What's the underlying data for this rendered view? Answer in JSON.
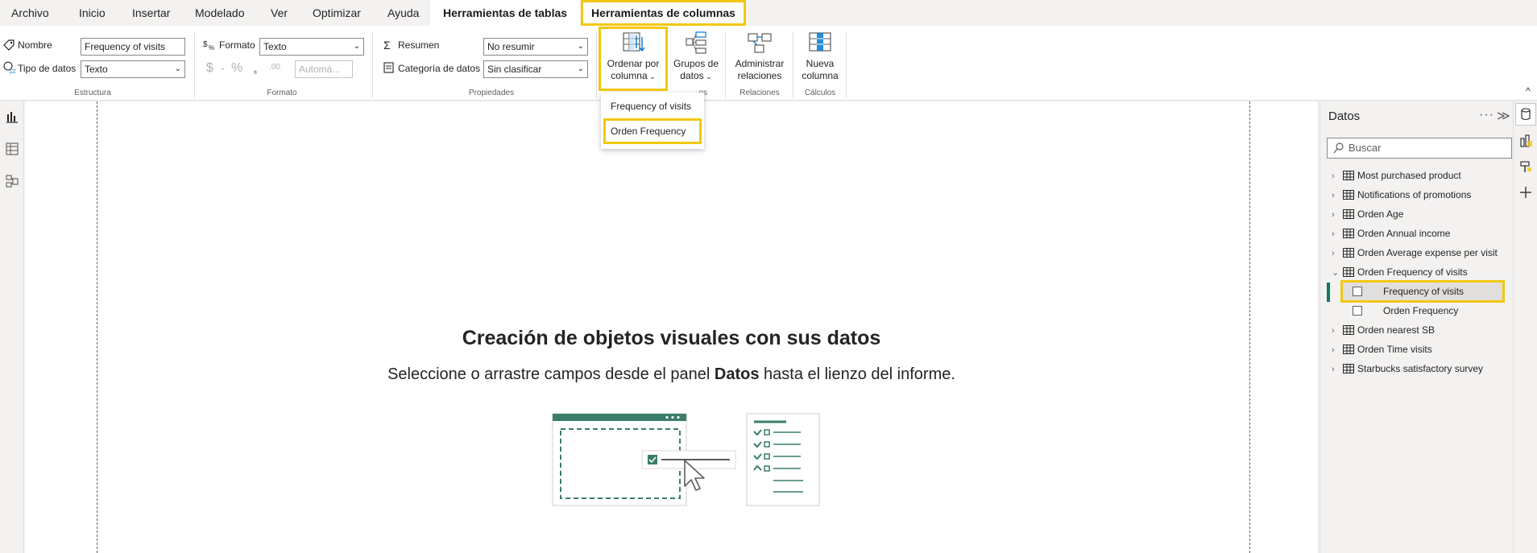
{
  "tabs": [
    {
      "label": "Archivo"
    },
    {
      "label": "Inicio"
    },
    {
      "label": "Insertar"
    },
    {
      "label": "Modelado"
    },
    {
      "label": "Ver"
    },
    {
      "label": "Optimizar"
    },
    {
      "label": "Ayuda"
    },
    {
      "label": "Herramientas de tablas"
    },
    {
      "label": "Herramientas de columnas"
    }
  ],
  "ribbon": {
    "estructura": {
      "nombre_label": "Nombre",
      "nombre_value": "Frequency of visits",
      "tipo_label": "Tipo de datos",
      "tipo_value": "Texto",
      "group_label": "Estructura"
    },
    "formato": {
      "formato_label": "Formato",
      "formato_value": "Texto",
      "currency_symbol": "$",
      "percent_symbol": "%",
      "comma_symbol": "❟",
      "decimals_symbol": ".00",
      "auto_value": "Automá...",
      "group_label": "Formato"
    },
    "propiedades": {
      "resumen_label": "Resumen",
      "resumen_value": "No resumir",
      "categoria_label": "Categoría de datos",
      "categoria_value": "Sin clasificar",
      "group_label": "Propiedades"
    },
    "ordenar": {
      "line1": "Ordenar por",
      "line2": "columna"
    },
    "grupos": {
      "line1": "Grupos de",
      "line2": "datos"
    },
    "relaciones": {
      "line1": "Administrar",
      "line2": "relaciones",
      "group_label": "Relaciones"
    },
    "calculos": {
      "line1": "Nueva",
      "line2": "columna",
      "group_label": "Cálculos"
    },
    "hidden_group_tail": "os"
  },
  "sort_dropdown": {
    "items": [
      {
        "label": "Frequency of visits"
      },
      {
        "label": "Orden Frequency"
      }
    ]
  },
  "canvas": {
    "title": "Creación de objetos visuales con sus datos",
    "subtitle_pre": "Seleccione o arrastre campos desde el panel ",
    "subtitle_bold": "Datos",
    "subtitle_post": " hasta el lienzo del informe."
  },
  "data_panel": {
    "title": "Datos",
    "more": "···",
    "collapse": "≫",
    "search_placeholder": "Buscar",
    "tables": [
      {
        "label": "Most purchased product",
        "expanded": false
      },
      {
        "label": "Notifications of promotions",
        "expanded": false
      },
      {
        "label": "Orden Age",
        "expanded": false
      },
      {
        "label": "Orden Annual income",
        "expanded": false
      },
      {
        "label": "Orden Average expense per visit",
        "expanded": false
      },
      {
        "label": "Orden Frequency of visits",
        "expanded": true
      },
      {
        "label": "Orden nearest SB",
        "expanded": false
      },
      {
        "label": "Orden Time visits",
        "expanded": false
      },
      {
        "label": "Starbucks satisfactory survey",
        "expanded": false
      }
    ],
    "fields": [
      {
        "label": "Frequency of visits",
        "selected": true
      },
      {
        "label": "Orden Frequency",
        "selected": false
      }
    ]
  },
  "colors": {
    "accent_highlight": "#f2c811",
    "powerbi_green": "#117865",
    "illustration_green": "#3a7d6b"
  }
}
